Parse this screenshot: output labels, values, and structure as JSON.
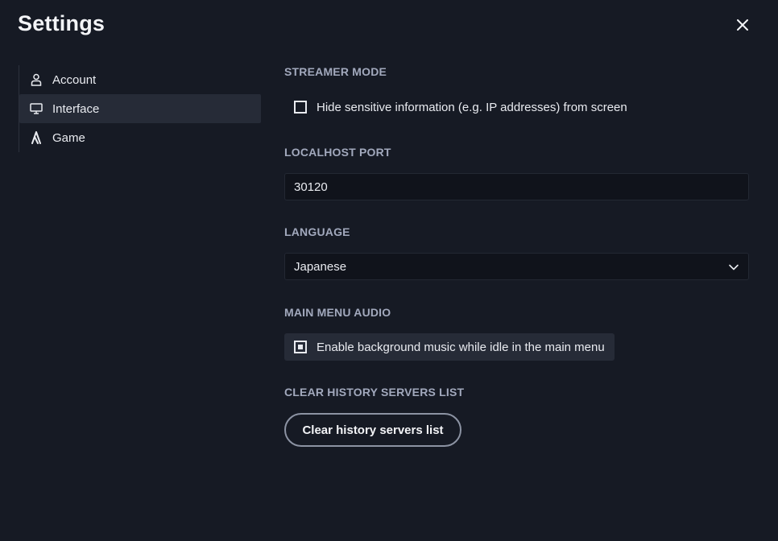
{
  "header": {
    "title": "Settings",
    "close_icon": "close-icon"
  },
  "sidebar": {
    "items": [
      {
        "label": "Account",
        "icon": "user-icon",
        "active": false
      },
      {
        "label": "Interface",
        "icon": "monitor-icon",
        "active": true
      },
      {
        "label": "Game",
        "icon": "game-logo-icon",
        "active": false
      }
    ]
  },
  "streamer_mode": {
    "label": "STREAMER MODE",
    "option_label": "Hide sensitive information (e.g. IP addresses) from screen",
    "checked": false
  },
  "localhost_port": {
    "label": "LOCALHOST PORT",
    "value": "30120"
  },
  "language": {
    "label": "LANGUAGE",
    "selected": "Japanese"
  },
  "main_menu_audio": {
    "label": "MAIN MENU AUDIO",
    "option_label": "Enable background music while idle in the main menu",
    "checked": true
  },
  "clear_history": {
    "label": "CLEAR HISTORY SERVERS LIST",
    "button_label": "Clear history servers list"
  },
  "colors": {
    "background": "#161a24",
    "active_item": "#262b37",
    "input_bg": "#10131b",
    "section_label": "#a2a9bd",
    "text": "#e9ebf0"
  }
}
